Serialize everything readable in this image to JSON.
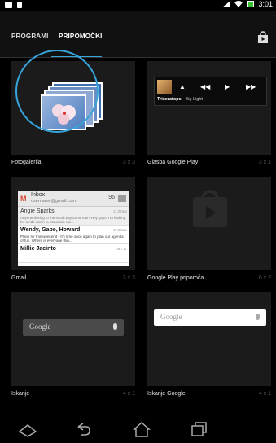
{
  "status_bar": {
    "time": "3:01"
  },
  "tabs": [
    {
      "label": "PROGRAMI",
      "active": false
    },
    {
      "label": "PRIPOMOČKI",
      "active": true
    }
  ],
  "colors": {
    "accent": "#36a3d9",
    "battery": "#39c233"
  },
  "widgets": [
    {
      "name": "Fotogalerija",
      "size": "3 x 3"
    },
    {
      "name": "Glasba Google Play",
      "size": "3 x 1"
    },
    {
      "name": "Gmail",
      "size": "3 x 3"
    },
    {
      "name": "Google Play priporoča",
      "size": "6 x 2"
    },
    {
      "name": "Iskanje",
      "size": "4 x 1"
    },
    {
      "name": "Iskanje Google",
      "size": "4 x 1"
    }
  ],
  "music": {
    "artist": "Triceratops",
    "separator": " - ",
    "song": "Big Light"
  },
  "gmail": {
    "title": "Inbox",
    "account": "username@gmail.com",
    "count": "96",
    "messages": [
      {
        "from": "Angie Sparks",
        "snippet": "Anyone driving to the south bay tomorrow? Hey guys, I'm looking for a ride down to Mountain Vie...",
        "time": "11:02am",
        "unread": false
      },
      {
        "from": "Wendy, Gabe, Howard",
        "snippet": "Plans for this weekend - It's time once again to plan our agenda of fun. Where is everyone thin...",
        "time": "11:29am",
        "unread": true
      },
      {
        "from": "Millie Jacinto",
        "snippet": "",
        "time": "Jan 17",
        "unread": true
      }
    ]
  },
  "search": {
    "label": "Google"
  },
  "icons": [
    "screenshot-icon",
    "document-icon",
    "no-sim-icon",
    "wifi-icon",
    "battery-icon",
    "play-store-icon",
    "menu-icon",
    "back-icon",
    "home-icon",
    "recent-apps-icon"
  ]
}
